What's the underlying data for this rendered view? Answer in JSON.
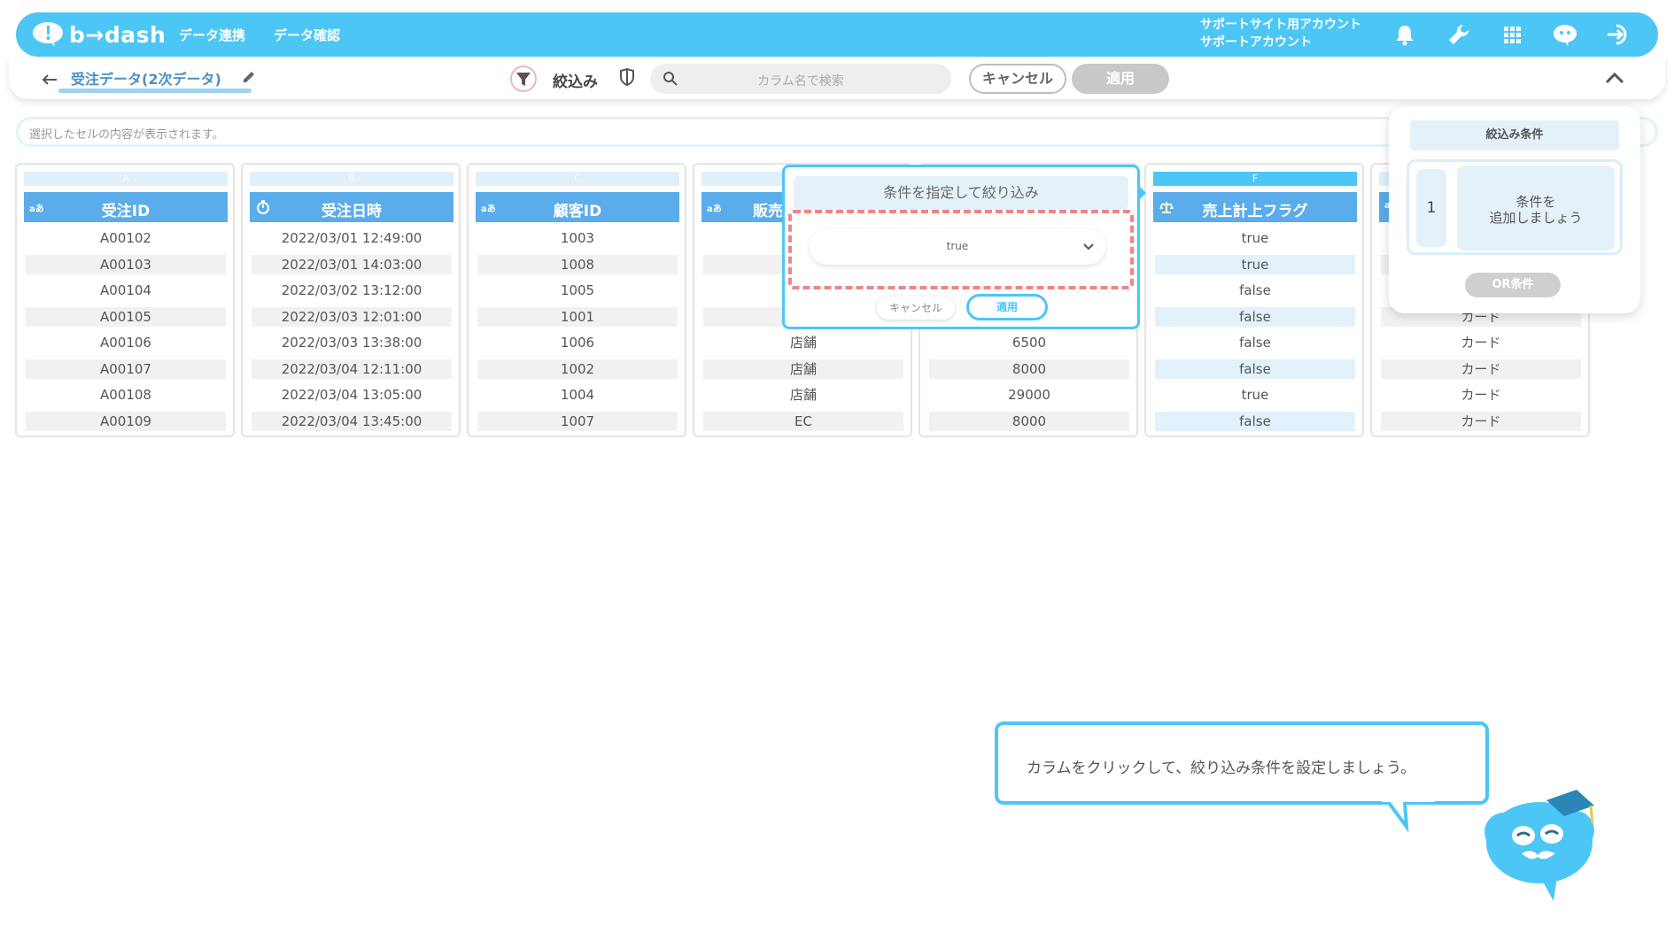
{
  "brand": {
    "name": "b→dash"
  },
  "nav": {
    "item1": "データ連携",
    "item2": "データ確認"
  },
  "account": {
    "line1": "サポートサイト用アカウント",
    "line2": "サポートアカウント"
  },
  "toolbar": {
    "table_name": "受注データ(2次データ)",
    "filter_label": "絞込み",
    "search_placeholder": "カラム名で検索",
    "cancel_label": "キャンセル",
    "apply_label": "適用"
  },
  "cellbar": {
    "placeholder": "選択したセルの内容が表示されます。"
  },
  "columns": [
    {
      "letter": "A",
      "type": "aあ",
      "name": "受注ID",
      "cells": [
        "A00102",
        "A00103",
        "A00104",
        "A00105",
        "A00106",
        "A00107",
        "A00108",
        "A00109"
      ]
    },
    {
      "letter": "B",
      "type": "",
      "name": "受注日時",
      "cells": [
        "2022/03/01 12:49:00",
        "2022/03/01 14:03:00",
        "2022/03/02 13:12:00",
        "2022/03/03 12:01:00",
        "2022/03/03 13:38:00",
        "2022/03/04 12:11:00",
        "2022/03/04 13:05:00",
        "2022/03/04 13:45:00"
      ]
    },
    {
      "letter": "C",
      "type": "aあ",
      "name": "顧客ID",
      "cells": [
        "1003",
        "1008",
        "1005",
        "1001",
        "1006",
        "1002",
        "1004",
        "1007"
      ]
    },
    {
      "letter": "",
      "type": "aあ",
      "name": "販売",
      "cells": [
        "",
        "",
        "",
        "",
        "店舗",
        "店舗",
        "店舗",
        "EC"
      ]
    },
    {
      "letter": "",
      "type": "",
      "name": "",
      "cells": [
        "",
        "",
        "",
        "",
        "6500",
        "8000",
        "29000",
        "8000"
      ]
    },
    {
      "letter": "F",
      "type": "",
      "name": "売上計上フラグ",
      "cells": [
        "true",
        "true",
        "false",
        "false",
        "false",
        "false",
        "true",
        "false"
      ]
    },
    {
      "letter": "",
      "type": "a",
      "name": "",
      "cells": [
        "",
        "",
        "",
        "カード",
        "カード",
        "カード",
        "カード",
        "カード"
      ]
    }
  ],
  "popup": {
    "title": "条件を指定して絞り込み",
    "selected_value": "true",
    "cancel_label": "キャンセル",
    "apply_label": "適用"
  },
  "side_panel": {
    "title": "絞込み条件",
    "number": "1",
    "add_line1": "条件を",
    "add_line2": "追加しましょう",
    "or_label": "OR条件"
  },
  "tip": {
    "text": "カラムをクリックして、絞り込み条件を設定しましょう。"
  },
  "colors": {
    "accent": "#4cc6f5",
    "header_col": "#5aacea",
    "dashed": "#f08486"
  }
}
